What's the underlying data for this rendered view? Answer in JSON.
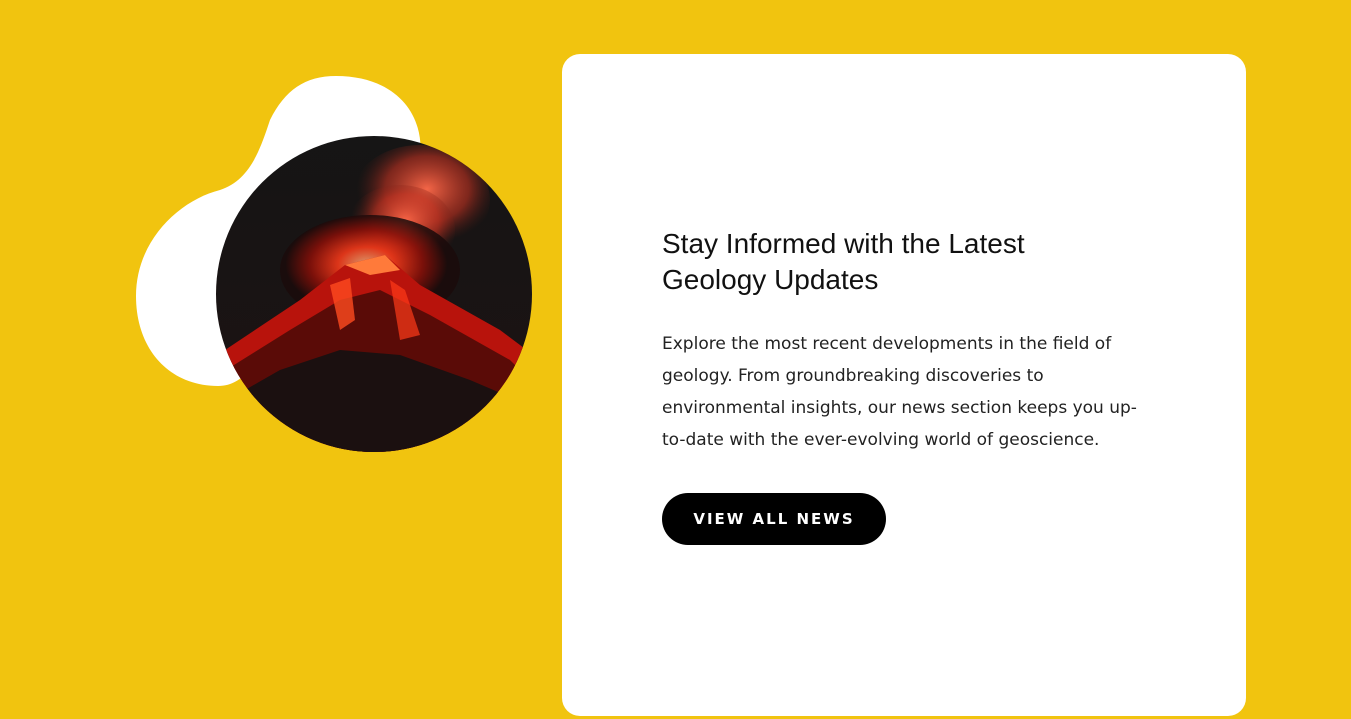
{
  "theme": {
    "background": "#F1C40F",
    "card": "#FFFFFF",
    "button_bg": "#000000",
    "button_text": "#FFFFFF"
  },
  "hero_image": {
    "icon": "volcano-eruption-image"
  },
  "news": {
    "title": "Stay Informed with the Latest Geology Updates",
    "body": "Explore the most recent developments in the field of geology. From groundbreaking discoveries to environmental insights, our news section keeps you up-to-date with the ever-evolving world of geoscience.",
    "cta_label": "VIEW ALL NEWS"
  }
}
